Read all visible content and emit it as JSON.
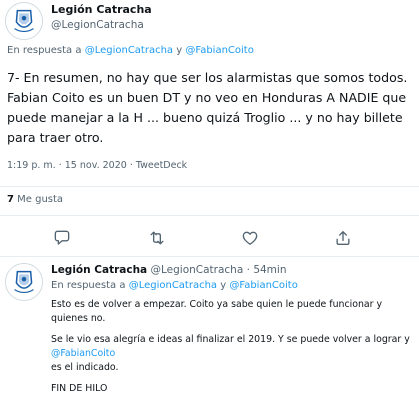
{
  "main_tweet": {
    "display_name": "Legión Catracha",
    "handle": "@LegionCatracha",
    "reply_prefix": "En respuesta a",
    "reply_mention_1": "@LegionCatracha",
    "reply_joiner": "y",
    "reply_mention_2": "@FabianCoito",
    "text": "7- En resumen, no hay que ser los alarmistas que somos todos. Fabian Coito es un buen DT y no veo en Honduras A NADIE que puede manejar a la H ... bueno quizá Troglio ... y no hay billete para traer otro.",
    "timestamp": "1:19 p. m. · 15 nov. 2020 ·",
    "app": "TweetDeck",
    "likes_count": "7",
    "likes_label": "Me gusta"
  },
  "actions": {
    "reply_icon": "reply-icon",
    "retweet_icon": "retweet-icon",
    "like_icon": "like-icon",
    "share_icon": "share-icon"
  },
  "reply_tweet": {
    "display_name": "Legión Catracha",
    "handle": "@LegionCatracha",
    "separator": "·",
    "time": "54min",
    "reply_prefix": "En respuesta a",
    "reply_mention_1": "@LegionCatracha",
    "reply_joiner": "y",
    "reply_mention_2": "@FabianCoito",
    "paragraph_1": "Esto es de volver a empezar. Coito ya sabe quien le puede funcionar y quienes no.",
    "paragraph_2_start": "Se le vio esa alegría e ideas al finalizar el 2019. Y se puede volver a lograr y",
    "paragraph_2_mention": "@FabianCoito",
    "paragraph_2_end": "es el indicado.",
    "paragraph_3": "FIN DE HILO"
  },
  "colors": {
    "text": "#0f1419",
    "secondary": "#536471",
    "link": "#1d9bf0",
    "divider": "#e6ecf0"
  }
}
